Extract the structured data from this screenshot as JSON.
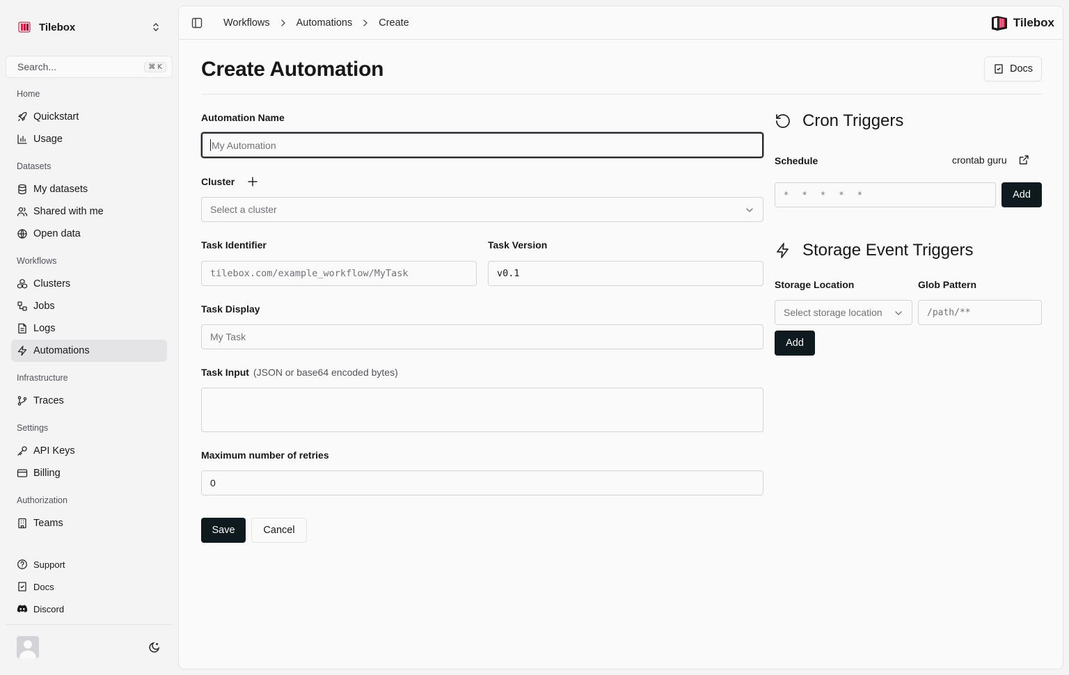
{
  "sidebar": {
    "workspace": {
      "name": "Tilebox"
    },
    "search": {
      "placeholder": "Search...",
      "shortcut": "⌘ K"
    },
    "groups": {
      "home": "Home",
      "datasets": "Datasets",
      "workflows": "Workflows",
      "infrastructure": "Infrastructure",
      "settings": "Settings",
      "authorization": "Authorization"
    },
    "items": {
      "quickstart": "Quickstart",
      "usage": "Usage",
      "my_datasets": "My datasets",
      "shared_with_me": "Shared with me",
      "open_data": "Open data",
      "clusters": "Clusters",
      "jobs": "Jobs",
      "logs": "Logs",
      "automations": "Automations",
      "traces": "Traces",
      "api_keys": "API Keys",
      "billing": "Billing",
      "teams": "Teams",
      "support": "Support",
      "docs": "Docs",
      "discord": "Discord"
    },
    "active_item": "Automations"
  },
  "header": {
    "breadcrumbs": [
      "Workflows",
      "Automations",
      "Create"
    ],
    "brand": "Tilebox"
  },
  "page": {
    "title": "Create Automation",
    "docs_button": "Docs"
  },
  "form": {
    "automation_name": {
      "label": "Automation Name",
      "placeholder": "My Automation",
      "value": ""
    },
    "cluster": {
      "label": "Cluster",
      "placeholder": "Select a cluster"
    },
    "task_identifier": {
      "label": "Task Identifier",
      "placeholder": "tilebox.com/example_workflow/MyTask"
    },
    "task_version": {
      "label": "Task Version",
      "value": "v0.1"
    },
    "task_display": {
      "label": "Task Display",
      "placeholder": "My Task"
    },
    "task_input": {
      "label": "Task Input",
      "hint": "(JSON or base64 encoded bytes)",
      "value": ""
    },
    "max_retries": {
      "label": "Maximum number of retries",
      "value": "0"
    },
    "save_label": "Save",
    "cancel_label": "Cancel"
  },
  "cron_triggers": {
    "title": "Cron Triggers",
    "schedule_label": "Schedule",
    "crontab_link": "crontab guru",
    "schedule_placeholder": "* * * * *",
    "add_label": "Add"
  },
  "storage_triggers": {
    "title": "Storage Event Triggers",
    "location_label": "Storage Location",
    "location_placeholder": "Select storage location",
    "glob_label": "Glob Pattern",
    "glob_placeholder": "/path/**",
    "add_label": "Add"
  },
  "colors": {
    "primary_button": "#0f1a1f",
    "active_nav_bg": "#e4e4e7",
    "brand_red": "#e11d48"
  }
}
